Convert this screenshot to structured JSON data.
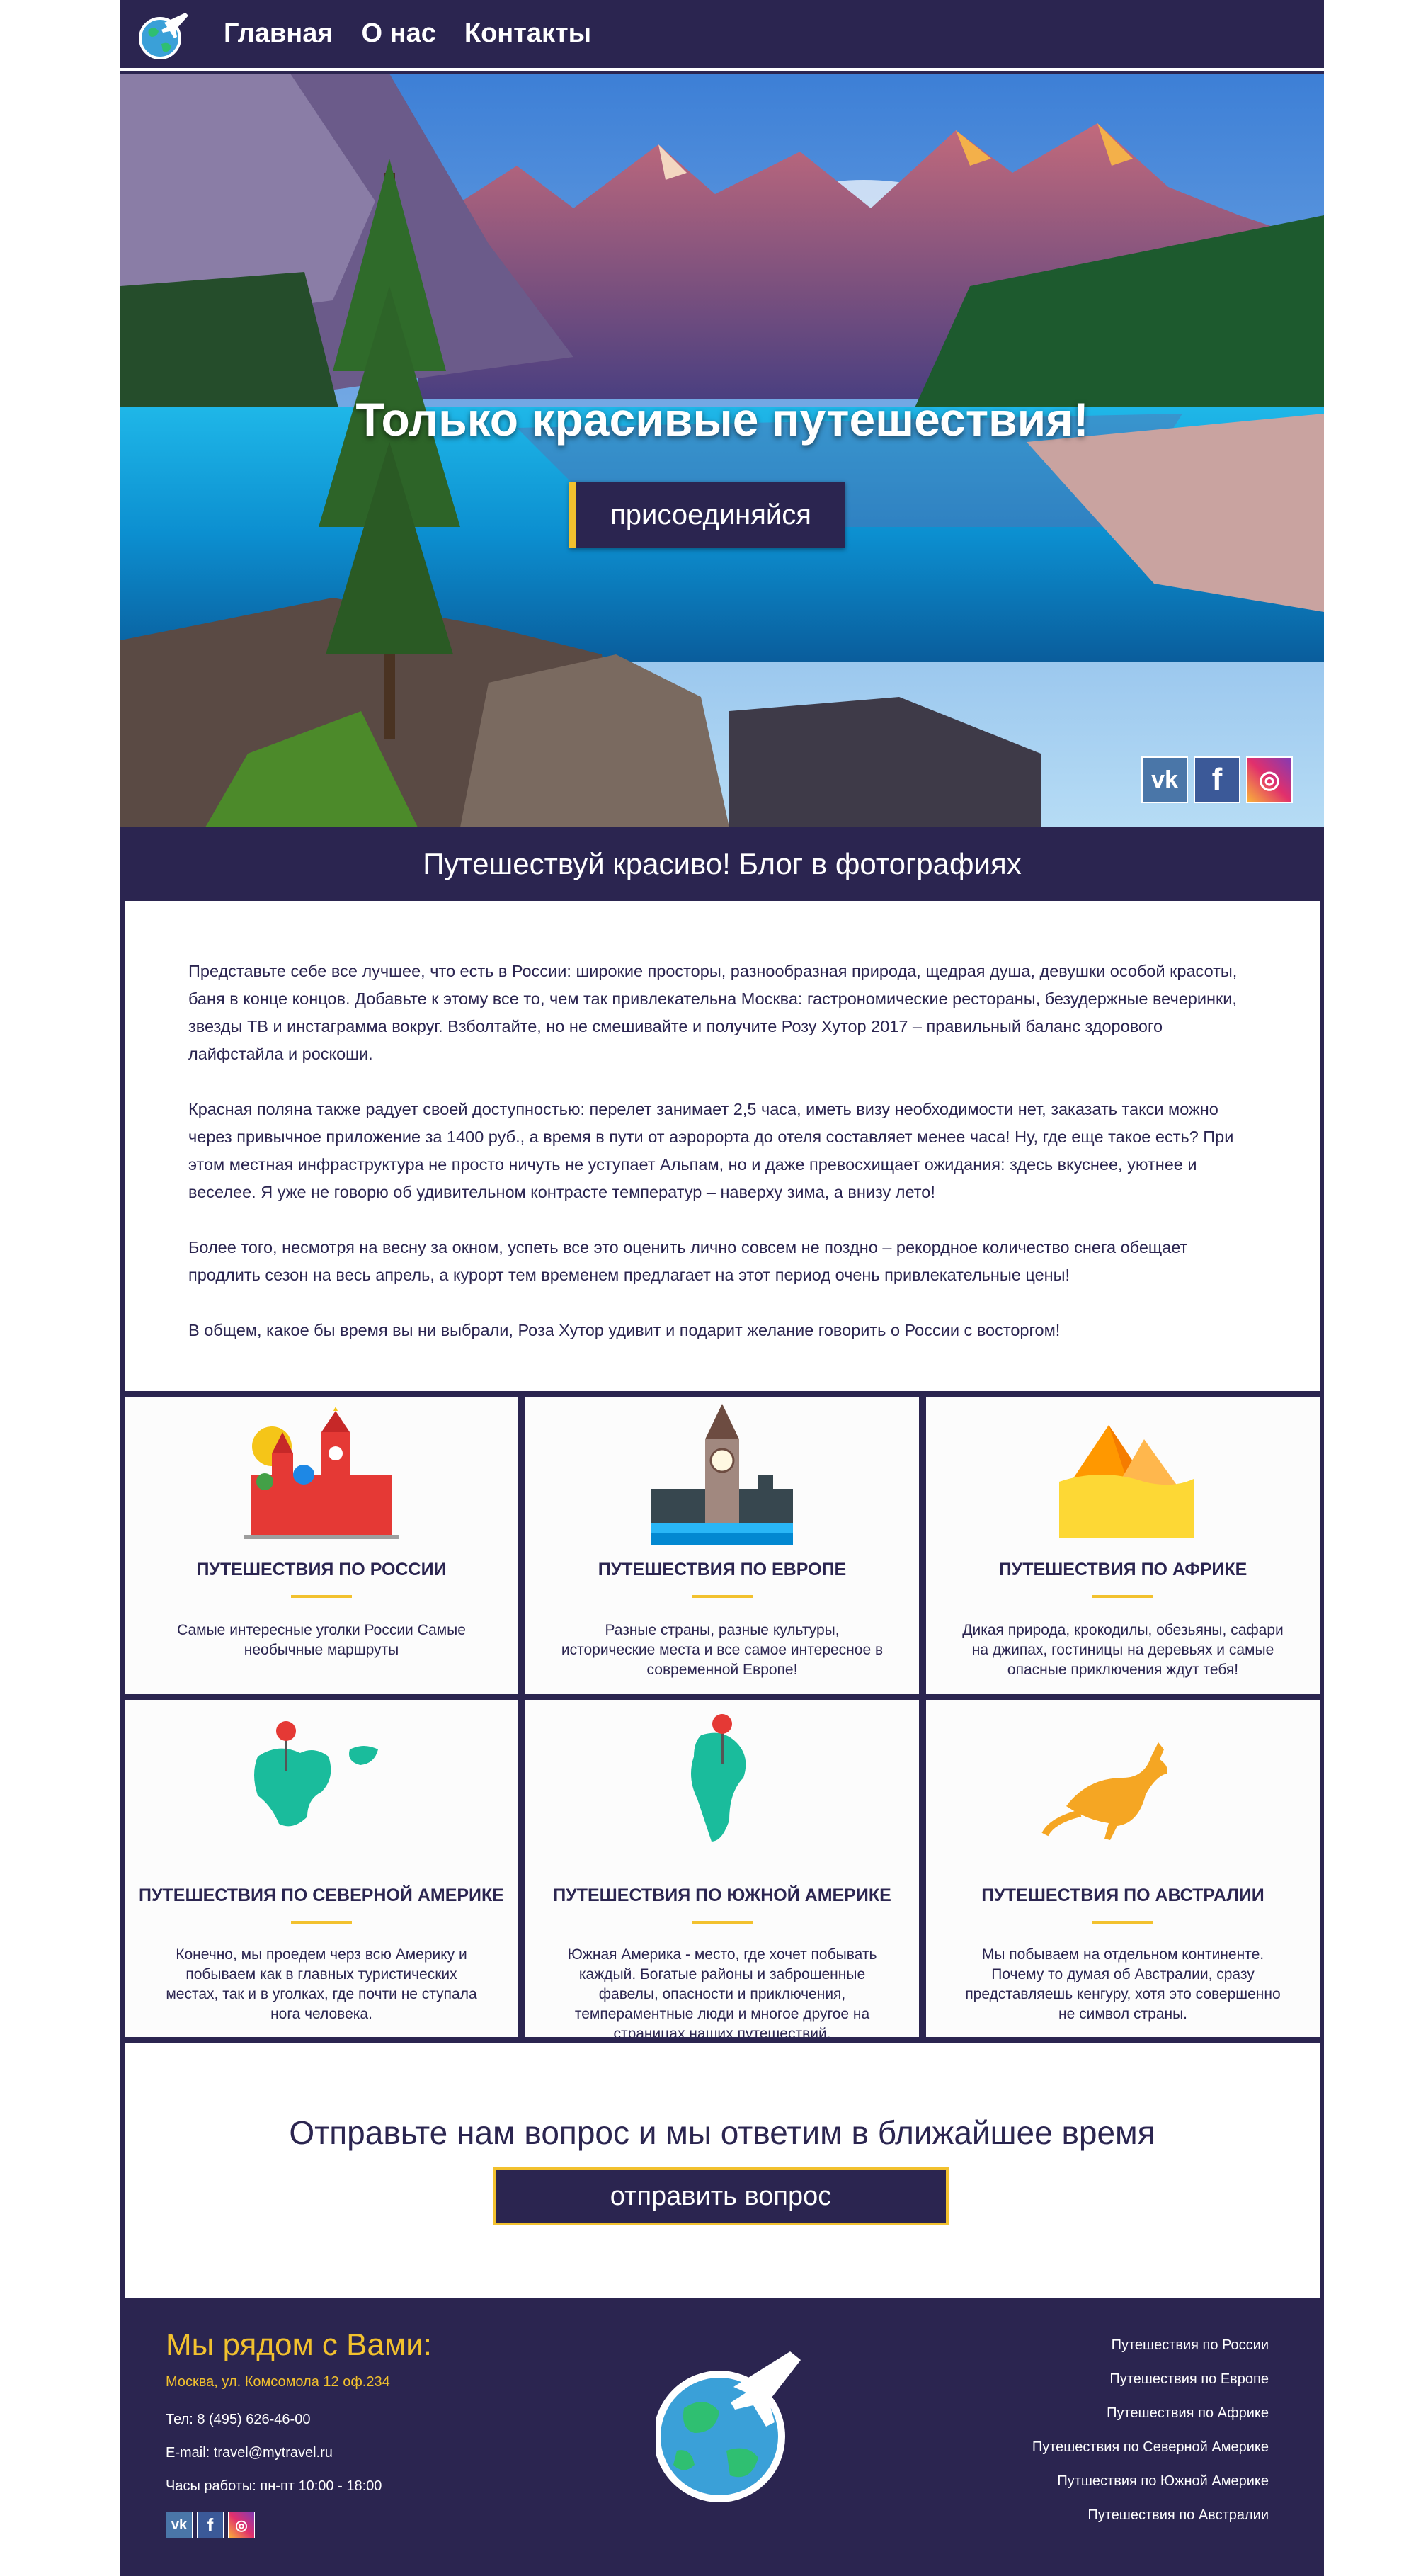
{
  "nav": {
    "links": [
      "Главная",
      "О нас",
      "Контакты"
    ]
  },
  "hero": {
    "title": "Только красивые путешествия!",
    "button_label": "присоединяйся"
  },
  "socials": {
    "vk": "vk",
    "fb": "f",
    "ig": "◎"
  },
  "blog": {
    "title": "Путешествуй красиво! Блог в фотографиях",
    "paragraphs": [
      "Представьте себе все лучшее, что есть в России: широкие просторы, разнообразная природа, щедрая душа, девушки особой красоты, баня в конце концов. Добавьте к этому все то, чем так привлекательна Москва: гастрономические рестораны, безудержные вечеринки, звезды ТВ и инстаграмма вокруг. Взболтайте, но не смешивайте и получите Розу Хутор 2017 – правильный баланс здорового лайфстайла и роскоши.",
      "Красная поляна также радует своей доступностью: перелет занимает 2,5 часа, иметь визу необходимости нет, заказать такси можно через привычное приложение за 1400 руб., а время в пути от аэророрта до отеля составляет менее часа! Ну, где еще такое есть? При этом местная инфраструктура не просто ничуть не уступает Альпам, но и даже превосхищает ожидания: здесь вкуснее, уютнее и веселее. Я уже не говорю об удивительном контрасте температур – наверху зима, а внизу лето!",
      "Более того, несмотря на весну за окном, успеть все это оценить лично совсем не поздно – рекордное количество снега обещает продлить сезон на весь апрель, а курорт тем временем предлагает на этот период очень привлекательные цены!",
      "В общем, какое бы время вы ни выбрали, Роза Хутор удивит и подарит желание говорить о России с восторгом!"
    ]
  },
  "cards": [
    {
      "title": "ПУТЕШЕСТВИЯ ПО РОССИИ",
      "desc": "Самые интересные уголки России Самые необычные маршруты",
      "icon": "kremlin-icon"
    },
    {
      "title": "ПУТЕШЕСТВИЯ ПО ЕВРОПЕ",
      "desc": "Разные страны, разные культуры, исторические места и все самое интересное в современной Европе!",
      "icon": "big-ben-icon"
    },
    {
      "title": "ПУТЕШЕСТВИЯ ПО АФРИКЕ",
      "desc": "Дикая природа, крокодилы, обезьяны, сафари на джипах, гостиницы на деревьях и самые опасные приключения ждут тебя!",
      "icon": "pyramids-icon"
    },
    {
      "title": "ПУТЕШЕСТВИЯ ПО СЕВЕРНОЙ АМЕРИКЕ",
      "desc": "Конечно, мы проедем черз всю Америку и побываем как в главных туристических местах, так и в уголках, где почти не ступала нога человека.",
      "icon": "north-america-map-icon"
    },
    {
      "title": "ПУТЕШЕСТВИЯ ПО ЮЖНОЙ АМЕРИКЕ",
      "desc": "Южная Америка - место, где хочет побывать каждый. Богатые районы и заброшенные фавелы, опасности и приключения, темпераментные люди и многое другое на страницах наших путешествий.",
      "icon": "south-america-map-icon"
    },
    {
      "title": "ПУТЕШЕСТВИЯ ПО АВСТРАЛИИ",
      "desc": "Мы побываем на отдельном континенте. Почему то думая об Австралии, сразу представляешь кенгуру, хотя это совершенно не символ страны.",
      "icon": "kangaroo-icon"
    }
  ],
  "question": {
    "title": "Отправьте нам вопрос и мы ответим в ближайшее время",
    "button_label": "отправить вопрос"
  },
  "footer": {
    "heading": "Мы рядом с Вами:",
    "address": "Москва, ул. Комсомола 12 оф.234",
    "phone": "Тел: 8 (495) 626-46-00",
    "email": "E-mail: travel@mytravel.ru",
    "hours": "Часы работы: пн-пт 10:00 - 18:00",
    "links": [
      "Путешествия по России",
      "Путешествия по Европе",
      "Путешествия по Африке",
      "Путешествия по Северной Америке",
      "Путшествия по Южной Америке",
      "Путешествия по Австралии"
    ]
  },
  "colors": {
    "primary": "#2b2550",
    "accent": "#f2c12e",
    "vk": "#4a76a8",
    "fb": "#3b5998"
  }
}
